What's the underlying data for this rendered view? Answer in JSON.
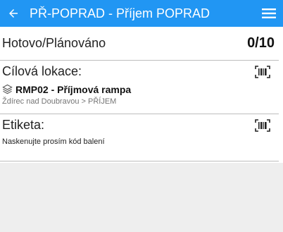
{
  "header": {
    "title": "PŘ-POPRAD - Příjem POPRAD",
    "back_icon": "arrow-left-icon",
    "menu_icon": "hamburger-menu-icon"
  },
  "progress": {
    "label": "Hotovo/Plánováno",
    "value": "0/10"
  },
  "location": {
    "label": "Cílová lokace:",
    "name": "RMP02 - Příjmová rampa",
    "path": "Ždírec nad Doubravou > PŘÍJEM",
    "icon": "layers-icon",
    "scan_icon": "barcode-scan-icon"
  },
  "label_field": {
    "label": "Etiketa:",
    "hint": "Naskenujte prosím kód balení",
    "scan_icon": "barcode-scan-icon"
  },
  "colors": {
    "appbar": "#2196f3",
    "background": "#eeeeee",
    "content": "#ffffff"
  }
}
